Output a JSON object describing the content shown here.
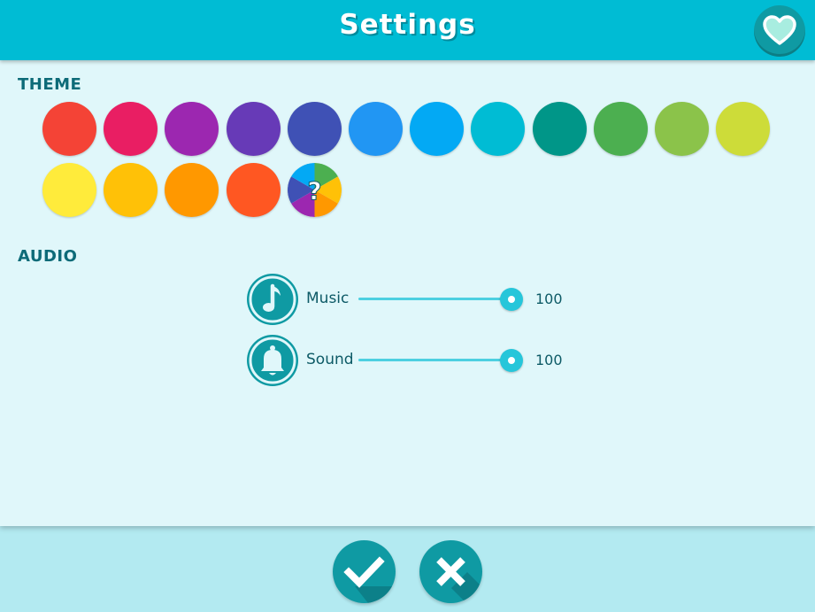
{
  "header": {
    "title": "Settings",
    "favorite_icon": "heart-icon"
  },
  "theme": {
    "label": "THEME",
    "colors": [
      "#f44336",
      "#e91e63",
      "#9c27b0",
      "#673ab7",
      "#3f51b5",
      "#2196f3",
      "#03a9f4",
      "#00bcd4",
      "#009688",
      "#4caf50",
      "#8bc34a",
      "#cddc39",
      "#ffeb3b",
      "#ffc107",
      "#ff9800",
      "#ff5722"
    ],
    "random_label": "?"
  },
  "audio": {
    "label": "AUDIO",
    "music": {
      "label": "Music",
      "value": "100",
      "level": 1.0,
      "icon": "music-note-icon"
    },
    "sound": {
      "label": "Sound",
      "value": "100",
      "level": 1.0,
      "icon": "bell-icon"
    }
  },
  "actions": {
    "confirm_icon": "check-icon",
    "cancel_icon": "close-icon"
  }
}
